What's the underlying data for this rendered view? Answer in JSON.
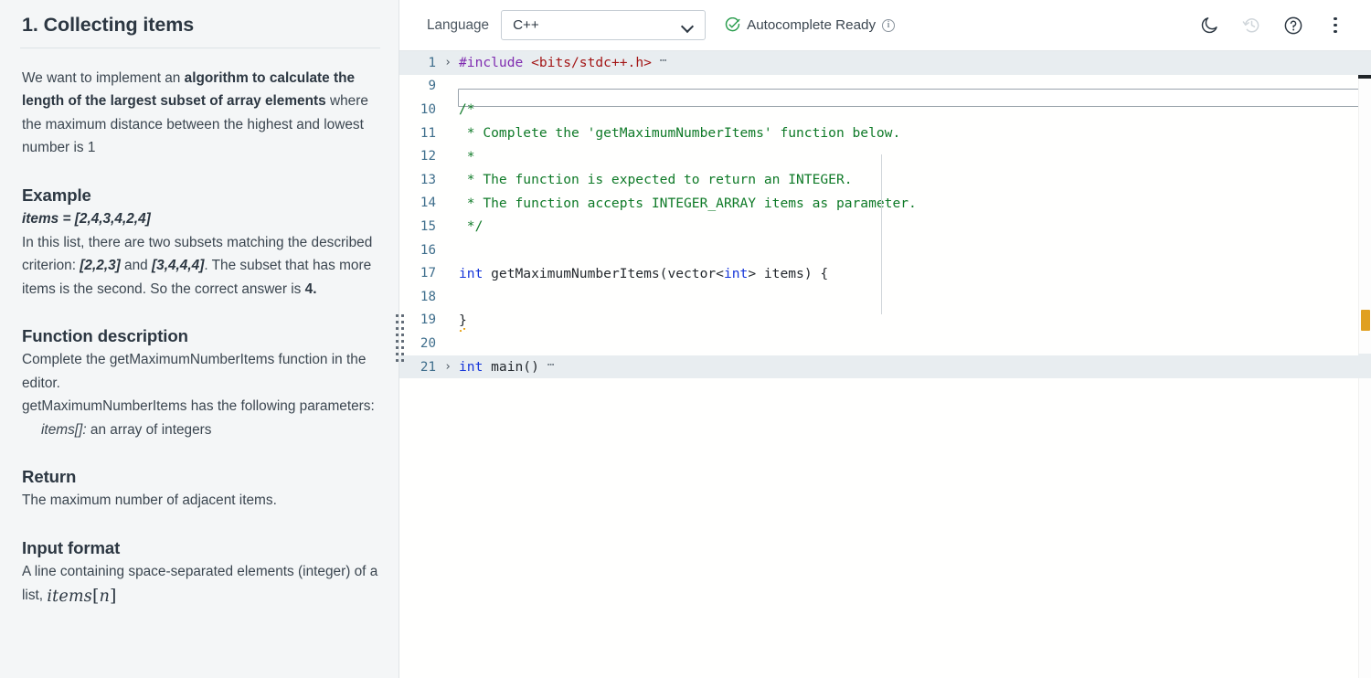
{
  "problem": {
    "title": "1. Collecting items",
    "intro": {
      "pre": "We want to implement an ",
      "bold": "algorithm to calculate the length of the largest subset of array elements",
      "post": " where the maximum distance between the highest and lowest number is 1"
    },
    "example": {
      "heading": "Example",
      "items_line": "items = [2,4,3,4,2,4]",
      "text_1": "In this list, there are two subsets matching the described criterion: ",
      "subset_a": "[2,2,3]",
      "text_2": " and ",
      "subset_b": "[3,4,4,4]",
      "text_3": ". The subset that has more items is the second. So the correct answer is ",
      "answer": "4.",
      "items_label": "items",
      "items_eq": " = ",
      "items_value": "[2,4,3,4,2,4]"
    },
    "function_description": {
      "heading": "Function description",
      "line_1": "Complete the getMaximumNumberItems function in the editor.",
      "line_2": "getMaximumNumberItems has the following parameters:",
      "param_name": "items[]:",
      "param_desc": " an array of integers"
    },
    "return": {
      "heading": "Return",
      "text": "The maximum number of adjacent items."
    },
    "input_format": {
      "heading": "Input format",
      "text": "A line containing space-separated elements (integer) of a list, ",
      "math_items": "items",
      "math_open": "[",
      "math_n": "n",
      "math_close": "]"
    }
  },
  "toolbar": {
    "language_label": "Language",
    "language_value": "C++",
    "language_options": [
      "C++"
    ],
    "autocomplete_status": "Autocomplete Ready",
    "info_glyph": "i",
    "icons": {
      "dark_mode": "moon-icon",
      "history": "history-icon",
      "help": "help-icon",
      "more": "more-vertical-icon"
    },
    "help_glyph": "?"
  },
  "editor": {
    "fold_glyph": "›",
    "ellipsis_glyph": "⋯",
    "lines": [
      {
        "num": "1",
        "fold": true,
        "highlight": true,
        "ellipsis": true,
        "tokens": [
          {
            "t": "#include",
            "c": "pre"
          },
          {
            "t": " ",
            "c": ""
          },
          {
            "t": "<bits/stdc++.h>",
            "c": "str"
          }
        ]
      },
      {
        "num": "9",
        "fold": false,
        "highlight": false,
        "ellipsis": false,
        "input_box": true,
        "tokens": []
      },
      {
        "num": "10",
        "fold": false,
        "highlight": false,
        "ellipsis": false,
        "tokens": [
          {
            "t": "/*",
            "c": "cmt"
          }
        ]
      },
      {
        "num": "11",
        "fold": false,
        "highlight": false,
        "ellipsis": false,
        "tokens": [
          {
            "t": " * Complete the 'getMaximumNumberItems' function below.",
            "c": "cmt"
          }
        ]
      },
      {
        "num": "12",
        "fold": false,
        "highlight": false,
        "ellipsis": false,
        "tokens": [
          {
            "t": " *",
            "c": "cmt"
          }
        ]
      },
      {
        "num": "13",
        "fold": false,
        "highlight": false,
        "ellipsis": false,
        "tokens": [
          {
            "t": " * The function is expected to return an INTEGER.",
            "c": "cmt"
          }
        ]
      },
      {
        "num": "14",
        "fold": false,
        "highlight": false,
        "ellipsis": false,
        "tokens": [
          {
            "t": " * The function accepts INTEGER_ARRAY items as parameter.",
            "c": "cmt"
          }
        ]
      },
      {
        "num": "15",
        "fold": false,
        "highlight": false,
        "ellipsis": false,
        "tokens": [
          {
            "t": " */",
            "c": "cmt"
          }
        ]
      },
      {
        "num": "16",
        "fold": false,
        "highlight": false,
        "ellipsis": false,
        "tokens": []
      },
      {
        "num": "17",
        "fold": false,
        "highlight": false,
        "ellipsis": false,
        "tokens": [
          {
            "t": "int",
            "c": "kw"
          },
          {
            "t": " getMaximumNumberItems(vector<",
            "c": ""
          },
          {
            "t": "int",
            "c": "kw"
          },
          {
            "t": "> items) {",
            "c": ""
          }
        ]
      },
      {
        "num": "18",
        "fold": false,
        "highlight": false,
        "ellipsis": false,
        "tokens": []
      },
      {
        "num": "19",
        "fold": false,
        "highlight": false,
        "ellipsis": false,
        "tokens": [
          {
            "t": "}",
            "c": "",
            "warn": true
          }
        ]
      },
      {
        "num": "20",
        "fold": false,
        "highlight": false,
        "ellipsis": false,
        "tokens": []
      },
      {
        "num": "21",
        "fold": true,
        "highlight": true,
        "ellipsis": true,
        "tokens": [
          {
            "t": "int",
            "c": "kw"
          },
          {
            "t": " main()",
            "c": ""
          }
        ]
      }
    ]
  },
  "colors": {
    "panel_bg": "#f4f6f7",
    "text": "#3b4650",
    "heading": "#2c3742",
    "accent_green": "#2a9d4e",
    "warning_amber": "#e0a020",
    "line_number": "#3f6e8c",
    "comment_green": "#0f7a28",
    "keyword_blue": "#1636d9",
    "preproc_purple": "#7f2bb0",
    "string_red": "#a31515"
  }
}
